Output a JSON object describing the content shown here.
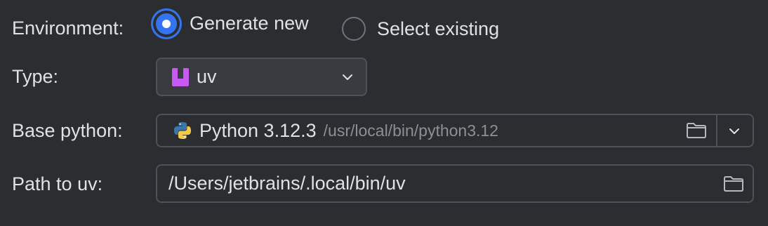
{
  "environment": {
    "label": "Environment:",
    "options": [
      {
        "label": "Generate new",
        "selected": true
      },
      {
        "label": "Select existing",
        "selected": false
      }
    ]
  },
  "type": {
    "label": "Type:",
    "value": "uv",
    "icon": "uv-icon"
  },
  "base_python": {
    "label": "Base python:",
    "version": "Python 3.12.3",
    "path": "/usr/local/bin/python3.12",
    "icon": "python-icon"
  },
  "path_to_uv": {
    "label": "Path to uv:",
    "value": "/Users/jetbrains/.local/bin/uv"
  },
  "colors": {
    "background": "#2b2d30",
    "accent": "#3574f0",
    "text": "#dfe1e5",
    "muted": "#8c8f94",
    "border": "#4e5157",
    "uv_icon": "#c75af3"
  }
}
